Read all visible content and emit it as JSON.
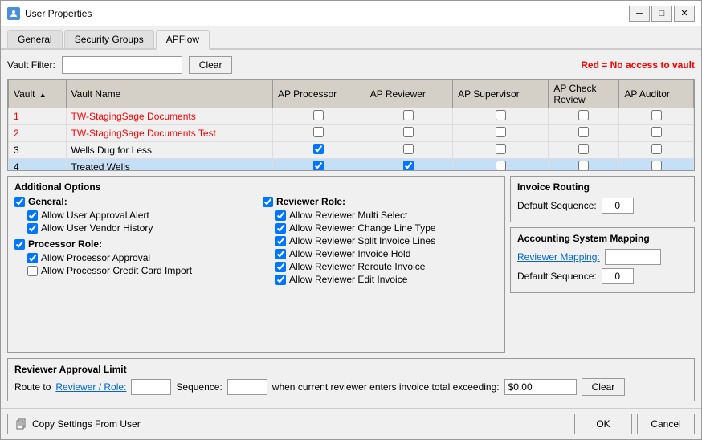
{
  "window": {
    "title": "User Properties",
    "icon": "user-icon"
  },
  "titlebar": {
    "minimize_label": "─",
    "restore_label": "□",
    "close_label": "✕"
  },
  "tabs": [
    {
      "id": "general",
      "label": "General",
      "active": false
    },
    {
      "id": "security-groups",
      "label": "Security Groups",
      "active": false
    },
    {
      "id": "apflow",
      "label": "APFlow",
      "active": true
    }
  ],
  "vault_filter": {
    "label": "Vault Filter:",
    "placeholder": "",
    "value": "",
    "clear_label": "Clear"
  },
  "red_note": {
    "prefix": "Red",
    "suffix": " = No access to vault"
  },
  "table": {
    "columns": [
      {
        "id": "vault",
        "label": "Vault",
        "sortable": true
      },
      {
        "id": "vault-name",
        "label": "Vault Name"
      },
      {
        "id": "ap-processor",
        "label": "AP Processor"
      },
      {
        "id": "ap-reviewer",
        "label": "AP Reviewer"
      },
      {
        "id": "ap-supervisor",
        "label": "AP Supervisor"
      },
      {
        "id": "ap-check-review",
        "label": "AP Check Review"
      },
      {
        "id": "ap-auditor",
        "label": "AP Auditor"
      }
    ],
    "rows": [
      {
        "vault": "1",
        "name": "TW-StagingSage Documents",
        "red": true,
        "ap_processor": false,
        "ap_reviewer": false,
        "ap_supervisor": false,
        "ap_check_review": false,
        "ap_auditor": false,
        "selected": false
      },
      {
        "vault": "2",
        "name": "TW-StagingSage Documents Test",
        "red": true,
        "ap_processor": false,
        "ap_reviewer": false,
        "ap_supervisor": false,
        "ap_check_review": false,
        "ap_auditor": false,
        "selected": false
      },
      {
        "vault": "3",
        "name": "Wells Dug for Less",
        "red": false,
        "ap_processor": true,
        "ap_reviewer": false,
        "ap_supervisor": false,
        "ap_check_review": false,
        "ap_auditor": false,
        "selected": false
      },
      {
        "vault": "4",
        "name": "Treated Wells",
        "red": false,
        "ap_processor": true,
        "ap_reviewer": true,
        "ap_supervisor": false,
        "ap_check_review": false,
        "ap_auditor": false,
        "selected": true
      }
    ]
  },
  "additional_options": {
    "title": "Additional Options",
    "general_checked": true,
    "general_label": "General:",
    "general_items": [
      {
        "id": "allow-user-approval-alert",
        "label": "Allow User Approval Alert",
        "checked": true
      },
      {
        "id": "allow-user-vendor-history",
        "label": "Allow User Vendor History",
        "checked": true
      }
    ],
    "processor_checked": true,
    "processor_label": "Processor Role:",
    "processor_items": [
      {
        "id": "allow-processor-approval",
        "label": "Allow Processor Approval",
        "checked": true
      },
      {
        "id": "allow-processor-credit-card",
        "label": "Allow Processor Credit Card Import",
        "checked": false
      }
    ],
    "reviewer_checked": true,
    "reviewer_label": "Reviewer Role:",
    "reviewer_items": [
      {
        "id": "allow-reviewer-multi-select",
        "label": "Allow Reviewer Multi Select",
        "checked": true
      },
      {
        "id": "allow-reviewer-change-line",
        "label": "Allow Reviewer Change Line Type",
        "checked": true
      },
      {
        "id": "allow-reviewer-split-invoice",
        "label": "Allow Reviewer Split Invoice Lines",
        "checked": true
      },
      {
        "id": "allow-reviewer-invoice-hold",
        "label": "Allow Reviewer Invoice Hold",
        "checked": true
      },
      {
        "id": "allow-reviewer-reroute",
        "label": "Allow Reviewer Reroute Invoice",
        "checked": true
      },
      {
        "id": "allow-reviewer-edit-invoice",
        "label": "Allow Reviewer Edit Invoice",
        "checked": true
      }
    ]
  },
  "invoice_routing": {
    "title": "Invoice Routing",
    "default_sequence_label": "Default Sequence:",
    "default_sequence_value": "0"
  },
  "accounting_mapping": {
    "title": "Accounting System Mapping",
    "reviewer_mapping_label": "Reviewer Mapping:",
    "reviewer_mapping_value": "",
    "default_sequence_label": "Default Sequence:",
    "default_sequence_value": "0"
  },
  "reviewer_approval": {
    "title": "Reviewer Approval Limit",
    "route_to_label": "Route to",
    "reviewer_role_label": "Reviewer / Role:",
    "reviewer_value": "",
    "sequence_label": "Sequence:",
    "sequence_value": "",
    "description": "when current reviewer enters invoice total exceeding:",
    "amount_value": "$0.00",
    "clear_label": "Clear"
  },
  "footer": {
    "copy_settings_label": "Copy Settings From User",
    "ok_label": "OK",
    "cancel_label": "Cancel"
  }
}
